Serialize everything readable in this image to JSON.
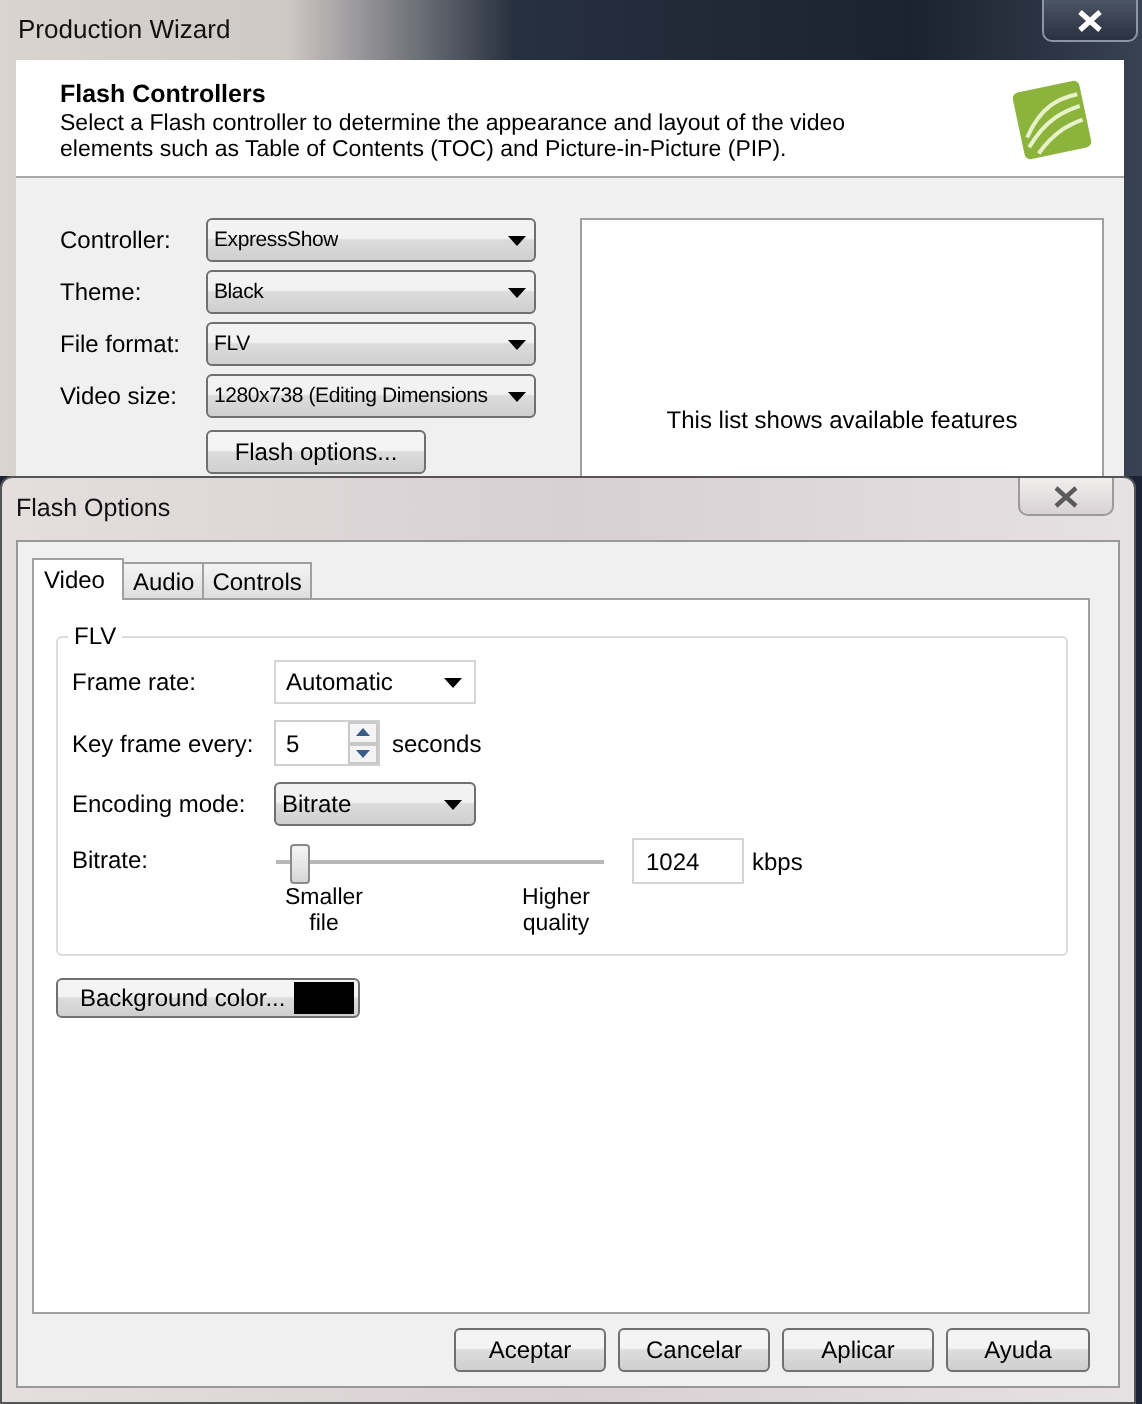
{
  "wizard": {
    "title": "Production Wizard",
    "heading": "Flash Controllers",
    "description": "Select a Flash controller to determine the appearance and layout of the video elements such as Table of Contents (TOC) and Picture-in-Picture (PIP).",
    "fields": [
      {
        "label": "Controller:",
        "value": "ExpressShow"
      },
      {
        "label": "Theme:",
        "value": "Black"
      },
      {
        "label": "File format:",
        "value": "FLV"
      },
      {
        "label": "Video size:",
        "value": "1280x738 (Editing Dimensions"
      }
    ],
    "options_button": "Flash options...",
    "features_text": "This list shows available features"
  },
  "dialog": {
    "title": "Flash Options",
    "tabs": [
      {
        "label": "Video",
        "selected": true
      },
      {
        "label": "Audio",
        "selected": false
      },
      {
        "label": "Controls",
        "selected": false
      }
    ],
    "group_title": "FLV",
    "frame_rate": {
      "label": "Frame rate:",
      "value": "Automatic"
    },
    "key_frame": {
      "label": "Key frame every:",
      "value": "5",
      "unit": "seconds"
    },
    "encoding_mode": {
      "label": "Encoding mode:",
      "value": "Bitrate"
    },
    "bitrate": {
      "label": "Bitrate:",
      "level": 0.04,
      "min_label": "Smaller file",
      "max_label": "Higher quality",
      "value": "1024",
      "unit": "kbps"
    },
    "background_button": {
      "label": "Background color...",
      "color": "#000000"
    },
    "buttons": [
      "Aceptar",
      "Cancelar",
      "Aplicar",
      "Ayuda"
    ]
  }
}
